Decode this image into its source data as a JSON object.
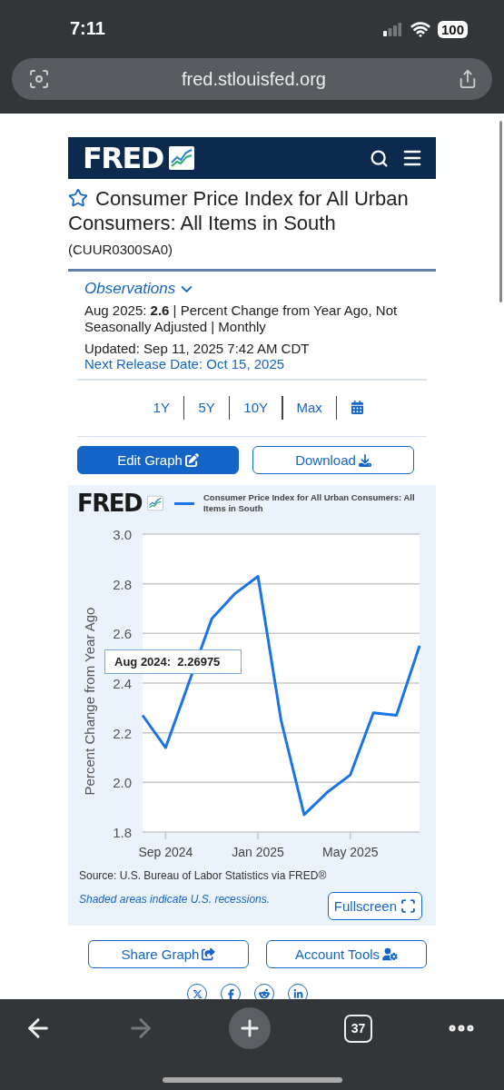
{
  "status_bar": {
    "time": "7:11",
    "battery": "100"
  },
  "address_bar": {
    "url": "fred.stlouisfed.org"
  },
  "site_header": {
    "logo": "FRED"
  },
  "series": {
    "title": "Consumer Price Index for All Urban Consumers: All Items in South",
    "favorite": false,
    "id": "(CUUR0300SA0)"
  },
  "observations": {
    "label": "Observations",
    "expanded": true,
    "latest": "Aug 2025: **2.6** | Percent Change from Year Ago, Not Seasonally Adjusted | Monthly",
    "updated": "Updated: Sep 11, 2025 7:42 AM CDT",
    "next_release": "Next Release Date: Oct 15, 2025"
  },
  "ranges": [
    {
      "label": "1Y"
    },
    {
      "label": "5Y"
    },
    {
      "label": "10Y"
    },
    {
      "label": "Max"
    }
  ],
  "actions": [
    {
      "label": "Edit Graph",
      "kind": "primary"
    },
    {
      "label": "Download",
      "kind": "outline"
    }
  ],
  "graph": {
    "logo": "FRED",
    "chart_data": {
      "type": "line",
      "ylabel": "Percent Change from Year Ago",
      "categories": [
        null,
        "Sep 2024",
        null,
        null,
        null,
        "Jan 2025",
        null,
        null,
        null,
        "May 2025",
        null,
        null,
        null
      ],
      "series": [
        {
          "name": "Consumer Price Index for All Urban Consumers: All Items in South",
          "color": "#1a73e8",
          "values": [
            2.27,
            2.14,
            null,
            2.66,
            2.76,
            2.83,
            2.25,
            1.87,
            1.96,
            2.03,
            2.28,
            2.27,
            2.55
          ]
        }
      ],
      "ylim": [
        1.8,
        3.0
      ],
      "grid": true,
      "yticks": [
        {
          "value": 1.8,
          "label": "1.8"
        },
        {
          "value": 2.0,
          "label": "2.0"
        },
        {
          "value": 2.2,
          "label": "2.2"
        },
        {
          "value": 2.4,
          "label": "2.4"
        },
        {
          "value": 2.6,
          "label": "2.6"
        },
        {
          "value": 2.8,
          "label": "2.8"
        },
        {
          "value": 3.0,
          "label": "3.0"
        }
      ]
    },
    "tooltip": "Aug 2024:  2.26975",
    "source": "Source: U.S. Bureau of Labor Statistics via FRED®",
    "note": "Shaded areas indicate U.S. recessions.",
    "fullscreen": "Fullscreen"
  },
  "more_actions": [
    {
      "label": "Share Graph",
      "kind": "share"
    },
    {
      "label": "Account Tools",
      "kind": "account"
    }
  ],
  "toolbar": {
    "back": {
      "disabled": false
    },
    "forward": {
      "disabled": true
    },
    "tab_count": "37"
  }
}
